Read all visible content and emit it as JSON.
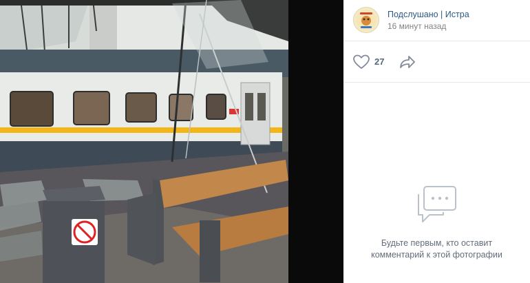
{
  "post": {
    "author": "Подслушано | Истра",
    "time": "16 минут назад"
  },
  "actions": {
    "likes_count": "27"
  },
  "comments": {
    "empty_line1": "Будьте первым, кто оставит",
    "empty_line2": "комментарий к этой фотографии"
  },
  "icons": {
    "avatar": "community-logo",
    "like": "heart-icon",
    "share": "share-arrow-icon",
    "comments": "comment-bubble-icon"
  },
  "colors": {
    "link": "#2a5885",
    "muted": "#828282",
    "icon": "#99a2ad",
    "train_stripe": "#f2b619"
  }
}
